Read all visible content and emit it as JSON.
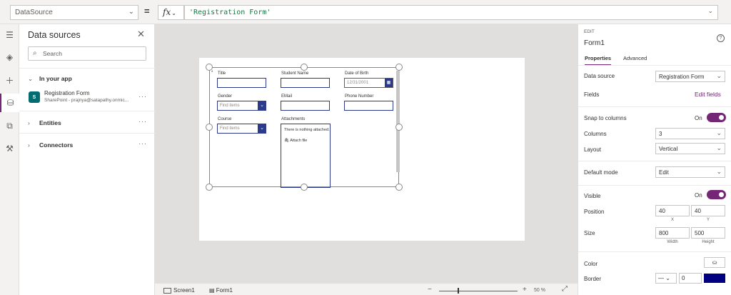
{
  "formula_bar": {
    "property": "DataSource",
    "equals": "=",
    "fx_label": "fx",
    "formula": "'Registration Form'"
  },
  "rail": {
    "icons": [
      "hamburger-icon",
      "layers-icon",
      "plus-icon",
      "database-icon",
      "media-icon",
      "tools-icon"
    ]
  },
  "data_sources": {
    "title": "Data sources",
    "search_placeholder": "Search",
    "in_your_app": "In your app",
    "source_name": "Registration Form",
    "source_sub": "SharePoint - prajnya@satapathy.onmic...",
    "entities": "Entities",
    "connectors": "Connectors",
    "more": "···"
  },
  "form": {
    "required_mark": "*",
    "title_label": "Title",
    "student_name_label": "Student Name",
    "dob_label": "Date of Birth",
    "dob_value": "12/31/2001",
    "gender_label": "Gender",
    "gender_placeholder": "Find items",
    "email_label": "EMail",
    "phone_label": "Phone Number",
    "course_label": "Course",
    "course_placeholder": "Find items",
    "attachments_label": "Attachments",
    "attachments_empty": "There is nothing attached.",
    "attach_file": "Attach file"
  },
  "bottom_bar": {
    "screen_tab": "Screen1",
    "form_tab": "Form1",
    "zoom_minus": "−",
    "zoom_plus": "+",
    "zoom": "50 %",
    "zoom_fraction": 0.24
  },
  "properties": {
    "edit_label": "EDIT",
    "control_name": "Form1",
    "help": "?",
    "tab_properties": "Properties",
    "tab_advanced": "Advanced",
    "data_source_label": "Data source",
    "data_source_value": "Registration Form",
    "fields_label": "Fields",
    "edit_fields": "Edit fields",
    "snap_label": "Snap to columns",
    "snap_state": "On",
    "columns_label": "Columns",
    "columns_value": "3",
    "layout_label": "Layout",
    "layout_value": "Vertical",
    "default_mode_label": "Default mode",
    "default_mode_value": "Edit",
    "visible_label": "Visible",
    "visible_state": "On",
    "position_label": "Position",
    "position_x": "40",
    "position_y": "40",
    "x_caption": "X",
    "y_caption": "Y",
    "size_label": "Size",
    "size_width": "800",
    "size_height": "500",
    "width_caption": "Width",
    "height_caption": "Height",
    "color_label": "Color",
    "border_label": "Border",
    "border_width": "0",
    "border_color": "#000080",
    "accent_color": "#742774"
  }
}
